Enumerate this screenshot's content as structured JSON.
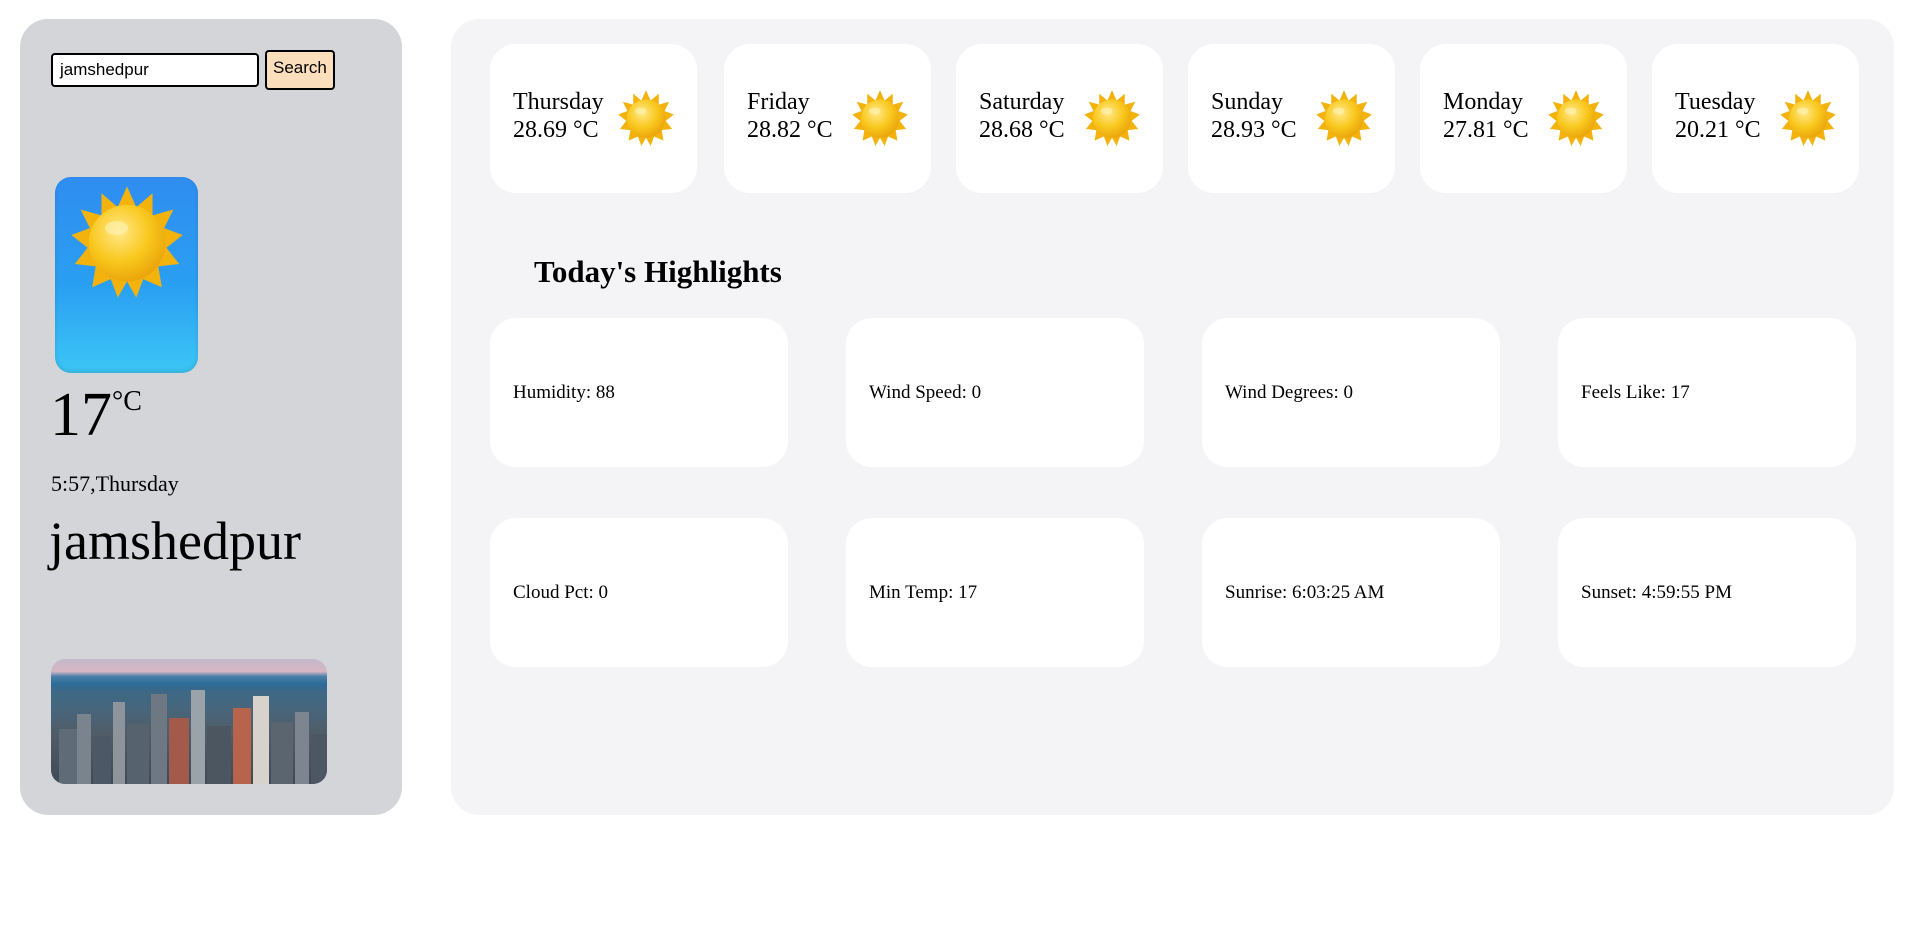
{
  "search": {
    "value": "jamshedpur",
    "button_label": "Search"
  },
  "current": {
    "icon": "sun-icon",
    "temp": "17",
    "unit": "°C",
    "datetime": "5:57,Thursday",
    "city": "jamshedpur"
  },
  "forecast": [
    {
      "day": "Thursday",
      "temp": "28.69 °C",
      "icon": "sun-icon"
    },
    {
      "day": "Friday",
      "temp": "28.82 °C",
      "icon": "sun-icon"
    },
    {
      "day": "Saturday",
      "temp": "28.68 °C",
      "icon": "sun-icon"
    },
    {
      "day": "Sunday",
      "temp": "28.93 °C",
      "icon": "sun-icon"
    },
    {
      "day": "Monday",
      "temp": "27.81 °C",
      "icon": "sun-icon"
    },
    {
      "day": "Tuesday",
      "temp": "20.21 °C",
      "icon": "sun-icon"
    }
  ],
  "highlights": {
    "title": "Today's Highlights",
    "items": [
      {
        "text": "Humidity: 88"
      },
      {
        "text": "Wind Speed: 0"
      },
      {
        "text": "Wind Degrees: 0"
      },
      {
        "text": "Feels Like: 17"
      },
      {
        "text": "Cloud Pct: 0"
      },
      {
        "text": "Min Temp: 17"
      },
      {
        "text": "Sunrise: 6:03:25 AM"
      },
      {
        "text": "Sunset: 4:59:55 PM"
      }
    ]
  },
  "colors": {
    "sidebar_bg": "#d4d5d9",
    "main_bg": "#f4f4f6",
    "search_button_bg": "#fbdfbd",
    "sun": "#f7c51c"
  }
}
